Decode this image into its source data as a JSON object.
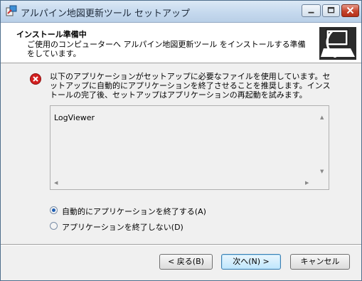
{
  "window": {
    "title": "アルパイン地図更新ツール セットアップ"
  },
  "header": {
    "title": "インストール準備中",
    "description": "ご使用のコンピューターへ アルパイン地図更新ツール をインストールする準備をしています。"
  },
  "message": {
    "icon": "error-icon",
    "text": "以下のアプリケーションがセットアップに必要なファイルを使用しています。セットアップに自動的にアプリケーションを終了させることを推奨します。インストールの完了後、セットアップはアプリケーションの再起動を試みます。"
  },
  "app_list": {
    "items": [
      "LogViewer"
    ]
  },
  "options": [
    {
      "label": "自動的にアプリケーションを終了する(A)",
      "selected": true
    },
    {
      "label": "アプリケーションを終了しない(D)",
      "selected": false
    }
  ],
  "buttons": {
    "back": "< 戻る(B)",
    "next": "次へ(N) >",
    "cancel": "キャンセル"
  }
}
